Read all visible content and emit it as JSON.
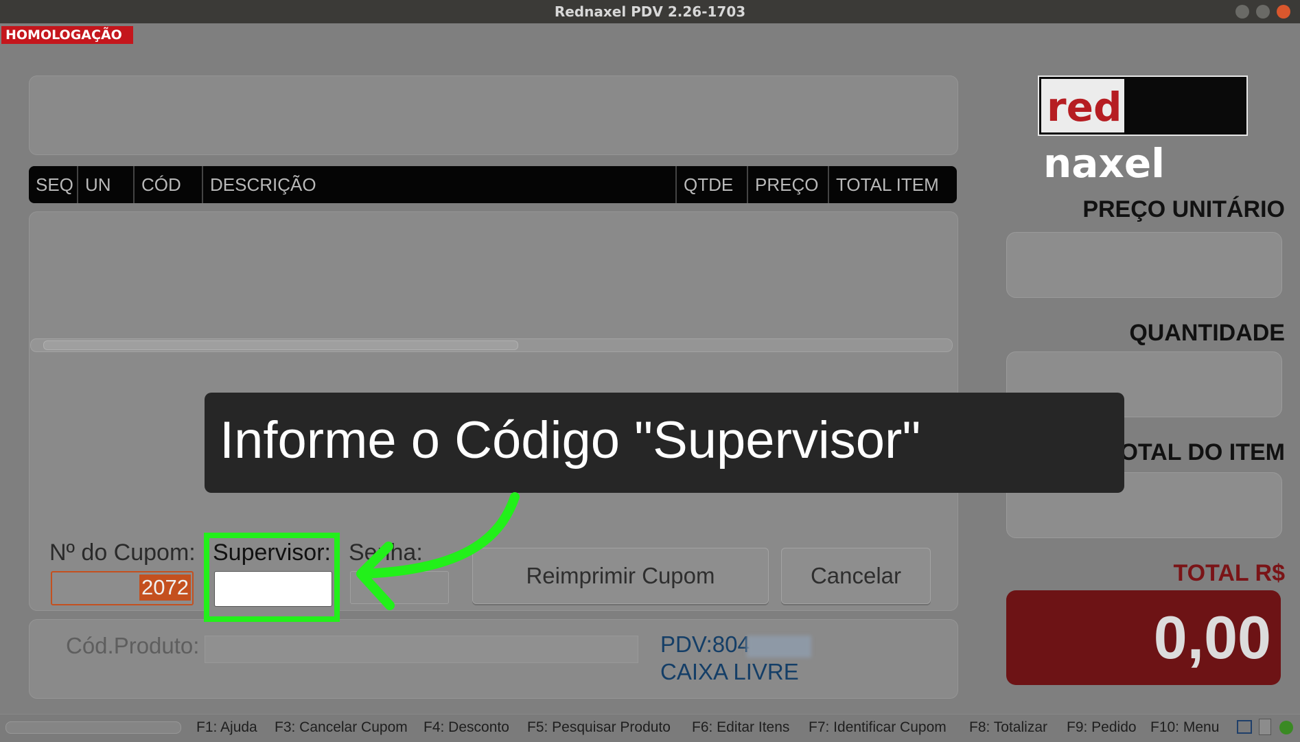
{
  "window": {
    "title": "Rednaxel PDV 2.26-1703"
  },
  "badge": {
    "environment": "HOMOLOGAÇÃO"
  },
  "grid": {
    "columns": [
      "SEQ",
      "UN",
      "CÓD",
      "DESCRIÇÃO",
      "QTDE",
      "PREÇO",
      "TOTAL ITEM"
    ],
    "rows": []
  },
  "logo": {
    "part1": "red",
    "part2": "naxel"
  },
  "right_panel": {
    "unit_price_label": "PREÇO UNITÁRIO",
    "quantity_label": "QUANTIDADE",
    "item_total_label": "TOTAL DO ITEM",
    "total_label": "TOTAL R$",
    "total_value": "0,00"
  },
  "reprint_form": {
    "coupon_label": "Nº do Cupom:",
    "coupon_value": "2072",
    "supervisor_label": "Supervisor:",
    "supervisor_value": "",
    "password_label": "Senha:",
    "reprint_button": "Reimprimir Cupom",
    "cancel_button": "Cancelar"
  },
  "bottom": {
    "product_code_label": "Cód.Produto:",
    "pdv_label": "PDV:804",
    "status": "CAIXA LIVRE"
  },
  "function_keys": [
    "F1: Ajuda",
    "F3: Cancelar Cupom",
    "F4: Desconto",
    "F5: Pesquisar Produto",
    "F6: Editar Itens",
    "F7: Identificar Cupom",
    "F8: Totalizar",
    "F9: Pedido",
    "F10: Menu"
  ],
  "overlay": {
    "instruction": "Informe o Código \"Supervisor\"",
    "arrow_color": "#22f01a"
  },
  "colors": {
    "brand_red": "#c4161c",
    "highlight_green": "#22f01a",
    "total_bg": "#6d1315"
  }
}
